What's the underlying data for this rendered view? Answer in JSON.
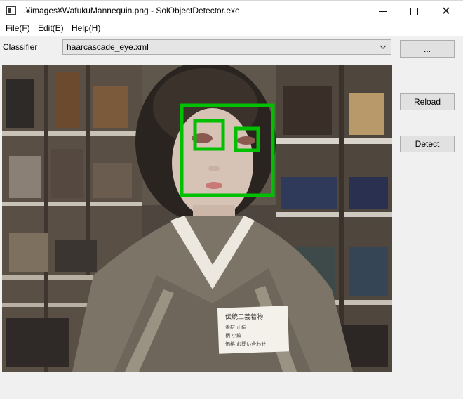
{
  "window": {
    "title": "..¥images¥WafukuMannequin.png - SolObjectDetector.exe",
    "minimize_glyph": "",
    "maximize_glyph": "",
    "close_glyph": "✕"
  },
  "menu": {
    "file": "File(F)",
    "edit": "Edit(E)",
    "help": "Help(H)"
  },
  "classifier": {
    "label": "Classifier",
    "selected": "haarcascade_eye.xml",
    "browse_label": "..."
  },
  "actions": {
    "reload_label": "Reload",
    "detect_label": "Detect"
  },
  "image": {
    "name": "WafukuMannequin.png",
    "detection_color": "#00c000",
    "note_lines": [
      "伝統工芸着物",
      "素材 正絹",
      "柄 小紋",
      "価格 お問い合わせ"
    ]
  },
  "icons": {
    "app": "window-app-icon",
    "combo": "chevron-down-icon"
  }
}
